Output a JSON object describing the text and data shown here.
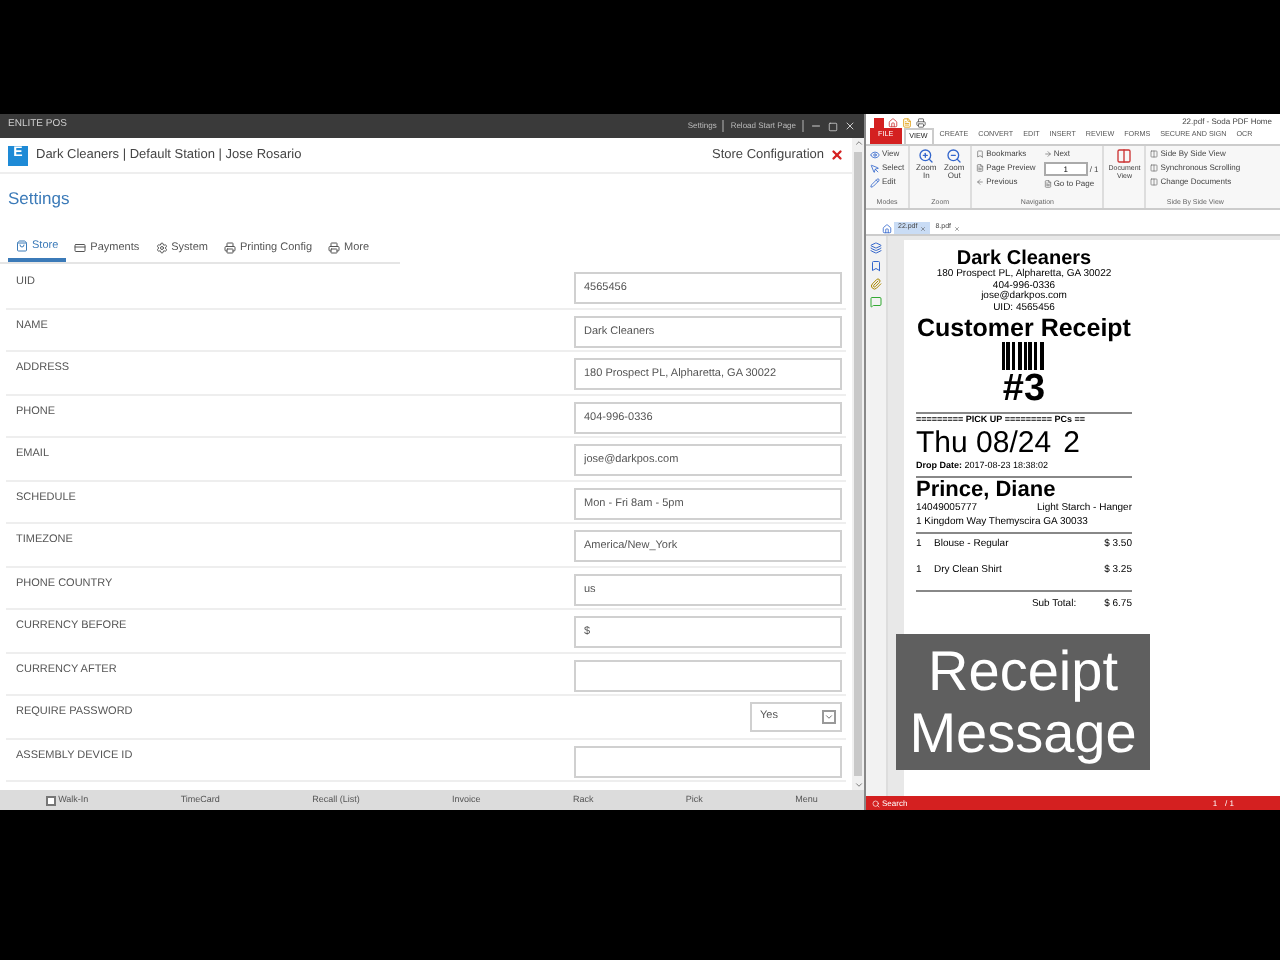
{
  "pos_window": {
    "title": "ENLITE POS",
    "title_links": [
      "Settings",
      "Reload Start Page"
    ],
    "header": {
      "logo": "E",
      "breadcrumb": "Dark Cleaners | Default Station | Jose Rosario",
      "section": "Store Configuration"
    },
    "heading": "Settings",
    "tabs": [
      {
        "label": "Store",
        "selected": true
      },
      {
        "label": "Payments",
        "selected": false
      },
      {
        "label": "System",
        "selected": false
      },
      {
        "label": "Printing Config",
        "selected": false
      },
      {
        "label": "More",
        "selected": false
      }
    ],
    "fields": [
      {
        "label": "UID",
        "kind": "text",
        "value": "4565456"
      },
      {
        "label": "NAME",
        "kind": "text",
        "value": "Dark Cleaners"
      },
      {
        "label": "ADDRESS",
        "kind": "text",
        "value": "180 Prospect PL, Alpharetta, GA 30022"
      },
      {
        "label": "PHONE",
        "kind": "text",
        "value": "404-996-0336"
      },
      {
        "label": "EMAIL",
        "kind": "text",
        "value": "jose@darkpos.com"
      },
      {
        "label": "SCHEDULE",
        "kind": "text",
        "value": "Mon - Fri 8am - 5pm"
      },
      {
        "label": "TIMEZONE",
        "kind": "text",
        "value": "America/New_York"
      },
      {
        "label": "PHONE COUNTRY",
        "kind": "text",
        "value": "us"
      },
      {
        "label": "CURRENCY BEFORE",
        "kind": "text",
        "value": "$"
      },
      {
        "label": "CURRENCY AFTER",
        "kind": "text"
      },
      {
        "label": "REQUIRE PASSWORD",
        "kind": "select",
        "value": "Yes"
      },
      {
        "label": "ASSEMBLY DEVICE ID",
        "kind": "text"
      }
    ],
    "bottom_bar": [
      {
        "label": "Walk-In",
        "kind": "checkbox",
        "checked": false
      },
      {
        "label": "TimeCard",
        "kind": "button"
      },
      {
        "label": "Recall (List)",
        "kind": "button"
      },
      {
        "label": "Invoice",
        "kind": "button"
      },
      {
        "label": "Rack",
        "kind": "button"
      },
      {
        "label": "Pick",
        "kind": "button"
      },
      {
        "label": "Menu",
        "kind": "button"
      }
    ]
  },
  "pdf_window": {
    "title": "22.pdf  -  Soda PDF Home",
    "ribbon_tabs": [
      {
        "label": "FILE",
        "kind": "file",
        "selected": false
      },
      {
        "label": "VIEW",
        "kind": "tab",
        "selected": true
      },
      {
        "label": "CREATE",
        "kind": "tab",
        "selected": false
      },
      {
        "label": "CONVERT",
        "kind": "tab",
        "selected": false
      },
      {
        "label": "EDIT",
        "kind": "tab",
        "selected": false
      },
      {
        "label": "INSERT",
        "kind": "tab",
        "selected": false
      },
      {
        "label": "REVIEW",
        "kind": "tab",
        "selected": false
      },
      {
        "label": "FORMS",
        "kind": "tab",
        "selected": false
      },
      {
        "label": "SECURE AND SIGN",
        "kind": "tab",
        "selected": false
      },
      {
        "label": "OCR",
        "kind": "tab",
        "selected": false
      }
    ],
    "ribbon": {
      "modes": {
        "label": "Modes",
        "items": [
          "View",
          "Select",
          "Edit"
        ]
      },
      "zoom": {
        "label": "Zoom",
        "items": [
          "Zoom In",
          "Zoom Out"
        ]
      },
      "navigation": {
        "label": "Navigation",
        "items": [
          "Bookmarks",
          "Page Preview",
          "Previous",
          "Next",
          "Go to Page"
        ],
        "page": "1",
        "page_count": "/ 1"
      },
      "document_view": {
        "label": "Document View"
      },
      "side_by_side": {
        "label": "Side By Side View",
        "items": [
          "Side By Side View",
          "Synchronous Scrolling",
          "Change Documents"
        ]
      }
    },
    "doc_tabs": [
      {
        "label": "22.pdf",
        "selected": true
      },
      {
        "label": "8.pdf",
        "selected": false
      }
    ],
    "receipt": {
      "store": "Dark Cleaners",
      "address_lines": [
        "180 Prospect PL, Alpharetta, GA 30022",
        "404-996-0336",
        "jose@darkpos.com",
        "UID: 4565456"
      ],
      "title": "Customer Receipt",
      "number": "#3",
      "pickup_rule": "========= PICK UP ========= PCs ==",
      "pickup_date": "Thu 08/24",
      "pieces": "2",
      "drop_date": "**Drop Date:** 2017-08-23 18:38:02",
      "customer": "Prince, Diane",
      "phone": "14049005777",
      "preference": "Light Starch - Hanger",
      "customer_address": "1 Kingdom Way Themyscira GA 30033",
      "items": [
        {
          "qty": "1",
          "name": "Blouse - Regular",
          "price": "$ 3.50"
        },
        {
          "qty": "1",
          "name": "Dry Clean Shirt",
          "price": "$ 3.25"
        }
      ],
      "totals": [
        {
          "label": "Sub Total:",
          "value": "$ 6.75"
        }
      ]
    },
    "status_bar": {
      "search": "Search",
      "page": "1",
      "page_count": "/ 1"
    }
  },
  "caption": [
    "Receipt",
    "Message"
  ]
}
